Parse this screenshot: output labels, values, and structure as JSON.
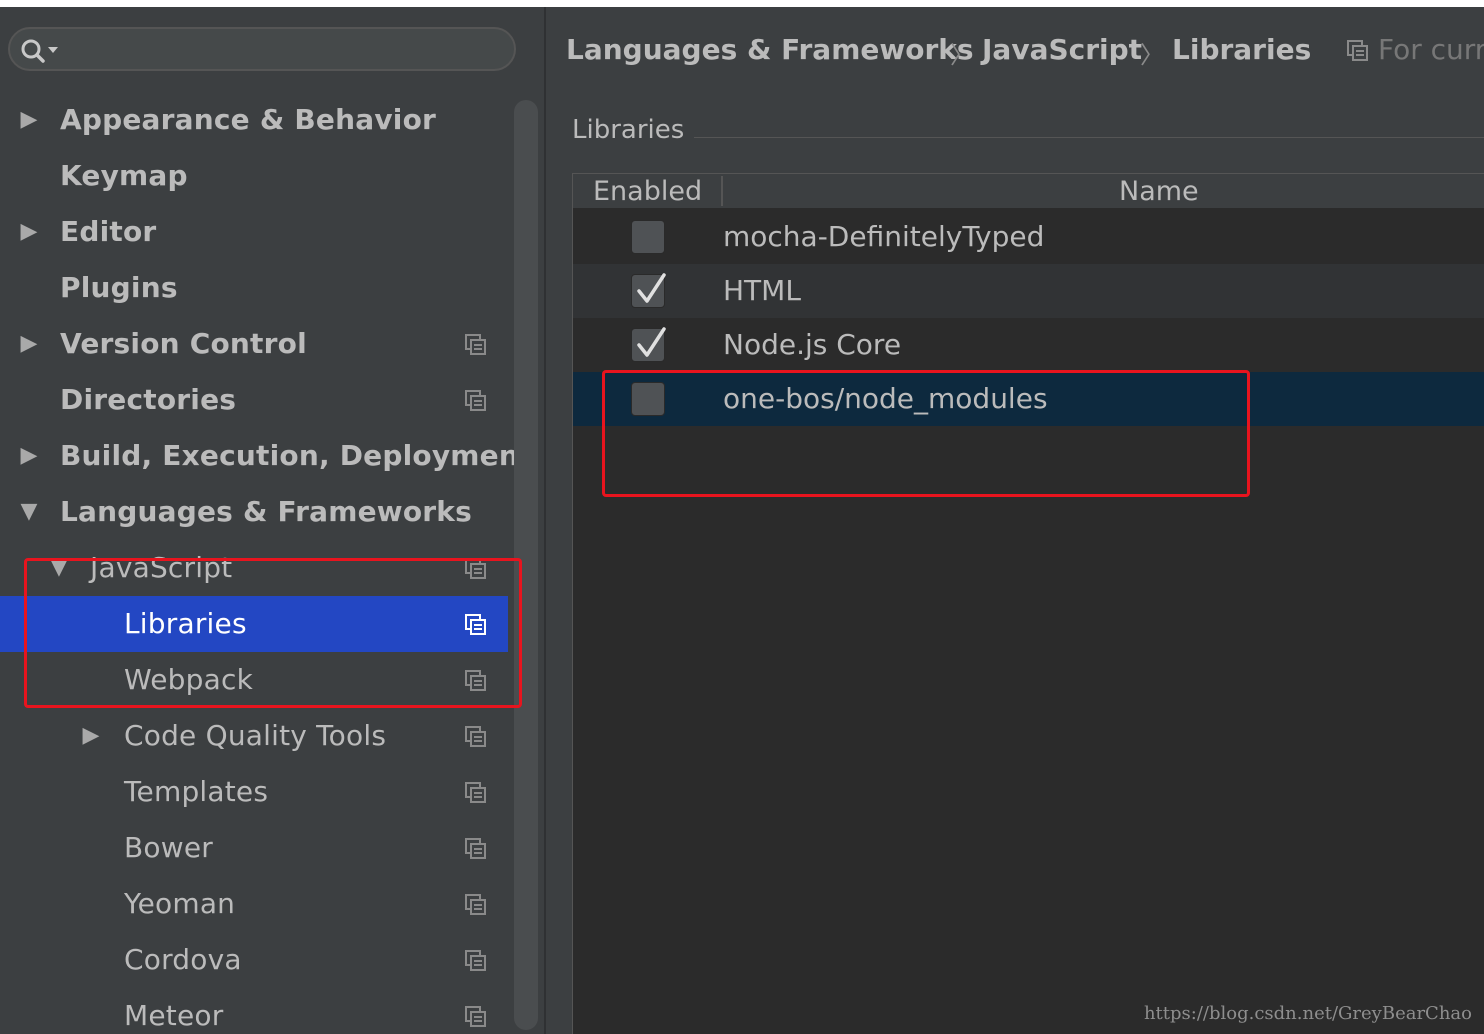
{
  "search": {
    "placeholder": ""
  },
  "sidebar": {
    "items": [
      {
        "label": "Appearance & Behavior",
        "arrow": "right",
        "indent": 0,
        "icon": false
      },
      {
        "label": "Keymap",
        "arrow": "none",
        "indent": 0,
        "icon": false
      },
      {
        "label": "Editor",
        "arrow": "right",
        "indent": 0,
        "icon": false
      },
      {
        "label": "Plugins",
        "arrow": "none",
        "indent": 0,
        "icon": false
      },
      {
        "label": "Version Control",
        "arrow": "right",
        "indent": 0,
        "icon": true
      },
      {
        "label": "Directories",
        "arrow": "none",
        "indent": 0,
        "icon": true
      },
      {
        "label": "Build, Execution, Deployment",
        "arrow": "right",
        "indent": 0,
        "icon": false
      },
      {
        "label": "Languages & Frameworks",
        "arrow": "down",
        "indent": 0,
        "icon": false
      },
      {
        "label": "JavaScript",
        "arrow": "down",
        "indent": 1,
        "icon": true
      },
      {
        "label": "Libraries",
        "arrow": "none",
        "indent": 2,
        "icon": true,
        "selected": true
      },
      {
        "label": "Webpack",
        "arrow": "none",
        "indent": 2,
        "icon": true
      },
      {
        "label": "Code Quality Tools",
        "arrow": "right",
        "indent": 1,
        "icon": true
      },
      {
        "label": "Templates",
        "arrow": "none",
        "indent": 2,
        "icon": true
      },
      {
        "label": "Bower",
        "arrow": "none",
        "indent": 2,
        "icon": true
      },
      {
        "label": "Yeoman",
        "arrow": "none",
        "indent": 2,
        "icon": true
      },
      {
        "label": "Cordova",
        "arrow": "none",
        "indent": 2,
        "icon": true
      },
      {
        "label": "Meteor",
        "arrow": "none",
        "indent": 2,
        "icon": true
      }
    ]
  },
  "breadcrumb": {
    "items": [
      "Languages & Frameworks",
      "JavaScript",
      "Libraries"
    ],
    "separator": "〉",
    "scope": "For curr"
  },
  "libraries": {
    "section_title": "Libraries",
    "columns": {
      "enabled": "Enabled",
      "name": "Name"
    },
    "rows": [
      {
        "name": "mocha-DefinitelyTyped",
        "enabled": false
      },
      {
        "name": "HTML",
        "enabled": true
      },
      {
        "name": "Node.js Core",
        "enabled": true
      },
      {
        "name": "one-bos/node_modules",
        "enabled": false,
        "selected": true
      }
    ]
  },
  "watermark": "https://blog.csdn.net/GreyBearChao",
  "colors": {
    "background": "#3c3f41",
    "selection": "#2347c3",
    "table_selection": "#0d293e",
    "annotation_red": "#e8141e"
  }
}
